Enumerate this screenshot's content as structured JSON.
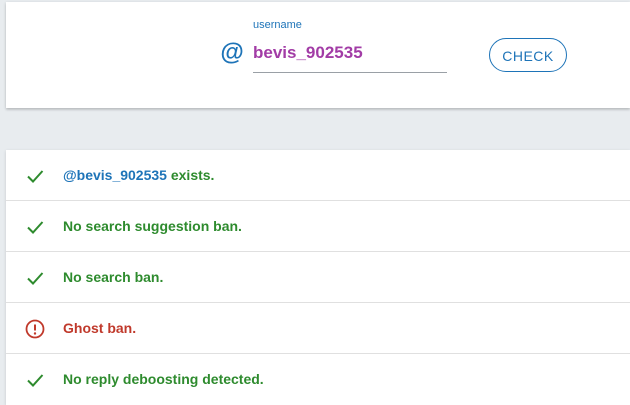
{
  "search": {
    "at_symbol": "@",
    "field_label": "username",
    "username_value": "bevis_902535",
    "check_label": "CHECK"
  },
  "results": {
    "exists": {
      "handle": "@bevis_902535",
      "text": " exists.",
      "status": "ok",
      "icon": "checkmark-icon"
    },
    "suggestion_ban": {
      "text": "No search suggestion ban.",
      "status": "ok",
      "icon": "checkmark-icon"
    },
    "search_ban": {
      "text": "No search ban.",
      "status": "ok",
      "icon": "checkmark-icon"
    },
    "ghost_ban": {
      "text": "Ghost ban.",
      "status": "bad",
      "icon": "alert-circle-icon"
    },
    "reply_deboosting": {
      "text": "No reply deboosting detected.",
      "status": "ok",
      "icon": "checkmark-icon"
    }
  },
  "colors": {
    "accent": "#1e74b8",
    "username": "#a23ca6",
    "ok": "#2e8b2e",
    "bad": "#c0392b"
  }
}
